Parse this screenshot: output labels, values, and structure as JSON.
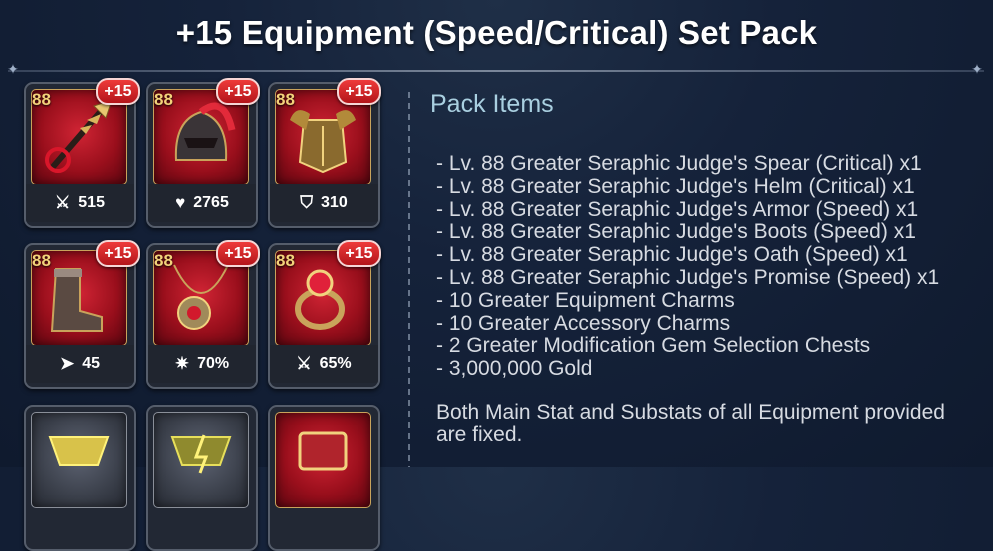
{
  "header": {
    "title": "+15 Equipment (Speed/Critical) Set Pack"
  },
  "cards": [
    {
      "level": "88",
      "badge": "+15",
      "stat_icon": "sword-icon",
      "stat_value": "515",
      "set": "critical"
    },
    {
      "level": "88",
      "badge": "+15",
      "stat_icon": "heart-icon",
      "stat_value": "2765",
      "set": "critical"
    },
    {
      "level": "88",
      "badge": "+15",
      "stat_icon": "shield-icon",
      "stat_value": "310",
      "set": "speed"
    },
    {
      "level": "88",
      "badge": "+15",
      "stat_icon": "speed-arrow-icon",
      "stat_value": "45",
      "set": "speed"
    },
    {
      "level": "88",
      "badge": "+15",
      "stat_icon": "critical-burst-icon",
      "stat_value": "70%",
      "set": "speed"
    },
    {
      "level": "88",
      "badge": "+15",
      "stat_icon": "sword-icon",
      "stat_value": "65%",
      "set": "speed"
    }
  ],
  "pack": {
    "title": "Pack Items",
    "items": [
      "- Lv. 88 Greater Seraphic Judge's Spear (Critical) x1",
      "- Lv. 88 Greater Seraphic Judge's Helm (Critical) x1",
      "- Lv. 88 Greater Seraphic Judge's Armor (Speed) x1",
      "- Lv. 88 Greater Seraphic Judge's Boots (Speed) x1",
      "- Lv. 88 Greater Seraphic Judge's Oath (Speed) x1",
      "- Lv. 88 Greater Seraphic Judge's Promise (Speed) x1",
      "- 10 Greater Equipment Charms",
      "- 10 Greater Accessory Charms",
      "- 2 Greater Modification Gem Selection Chests",
      "- 3,000,000 Gold"
    ],
    "note": "Both Main Stat and Substats of all Equipment provided are fixed."
  },
  "colors": {
    "badge_red": "#d22a2c",
    "card_red": "#9a0f1c",
    "accent_gold": "#d79a45",
    "title_blue": "#a9cfe0"
  }
}
